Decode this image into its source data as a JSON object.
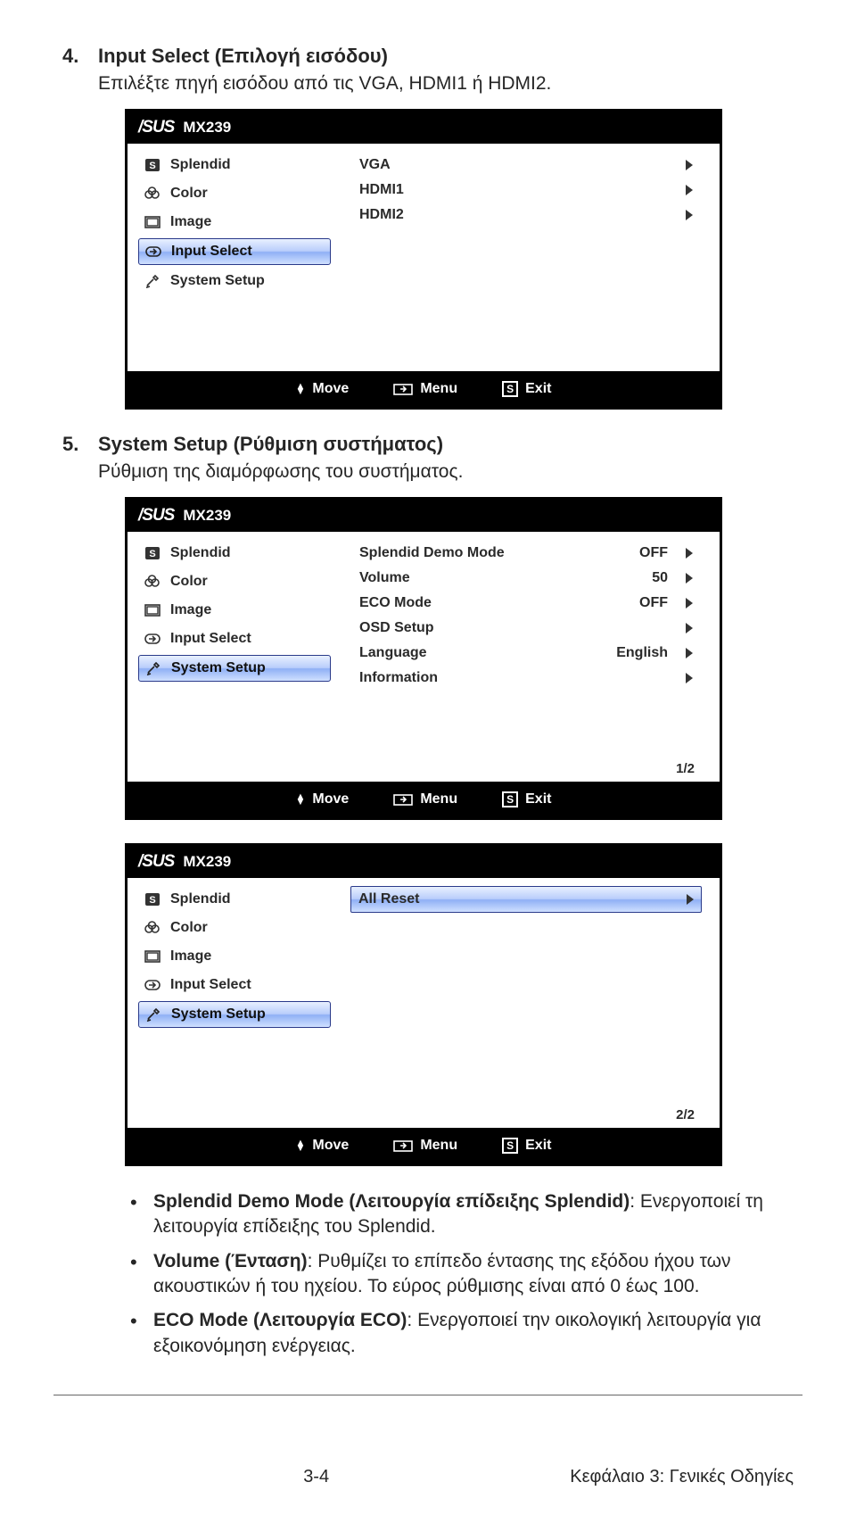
{
  "sections": {
    "s4": {
      "num": "4.",
      "title": "Input Select (Επιλογή εισόδου)",
      "sub": "Επιλέξτε πηγή εισόδου από τις VGA, HDMI1 ή HDMI2."
    },
    "s5": {
      "num": "5.",
      "title": "System Setup (Ρύθμιση συστήματος)",
      "sub": "Ρύθμιση της διαμόρφωσης του συστήματος."
    }
  },
  "osd": {
    "brand": "/SUS",
    "model": "MX239",
    "left": {
      "splendid": "Splendid",
      "color": "Color",
      "image": "Image",
      "input_select": "Input Select",
      "system_setup": "System Setup"
    },
    "footer": {
      "move": "Move",
      "menu": "Menu",
      "exit": "Exit"
    }
  },
  "panel1": {
    "items": {
      "vga": "VGA",
      "hdmi1": "HDMI1",
      "hdmi2": "HDMI2"
    }
  },
  "panel2": {
    "items": {
      "demo": {
        "label": "Splendid Demo Mode",
        "val": "OFF"
      },
      "volume": {
        "label": "Volume",
        "val": "50"
      },
      "eco": {
        "label": "ECO Mode",
        "val": "OFF"
      },
      "osd": {
        "label": "OSD Setup",
        "val": ""
      },
      "lang": {
        "label": "Language",
        "val": "English"
      },
      "info": {
        "label": "Information",
        "val": ""
      }
    },
    "page_ind": "1/2"
  },
  "panel3": {
    "all_reset": "All Reset",
    "page_ind": "2/2"
  },
  "bullets": {
    "b1_bold": "Splendid Demo Mode (Λειτουργία επίδειξης Splendid)",
    "b1_rest": ": Ενεργοποιεί τη λειτουργία επίδειξης του Splendid.",
    "b2_bold": "Volume (Ένταση)",
    "b2_rest": ": Ρυθμίζει το επίπεδο έντασης της εξόδου ήχου των ακουστικών ή του ηχείου. Το εύρος ρύθμισης είναι από 0 έως 100.",
    "b3_bold": "ECO Mode (Λειτουργία ECO)",
    "b3_rest": ": Ενεργοποιεί την οικολογική λειτουργία για εξοικονόμηση ενέργειας."
  },
  "page_footer": {
    "left": "3-4",
    "right": "Κεφάλαιο 3: Γενικές Οδηγίες"
  }
}
